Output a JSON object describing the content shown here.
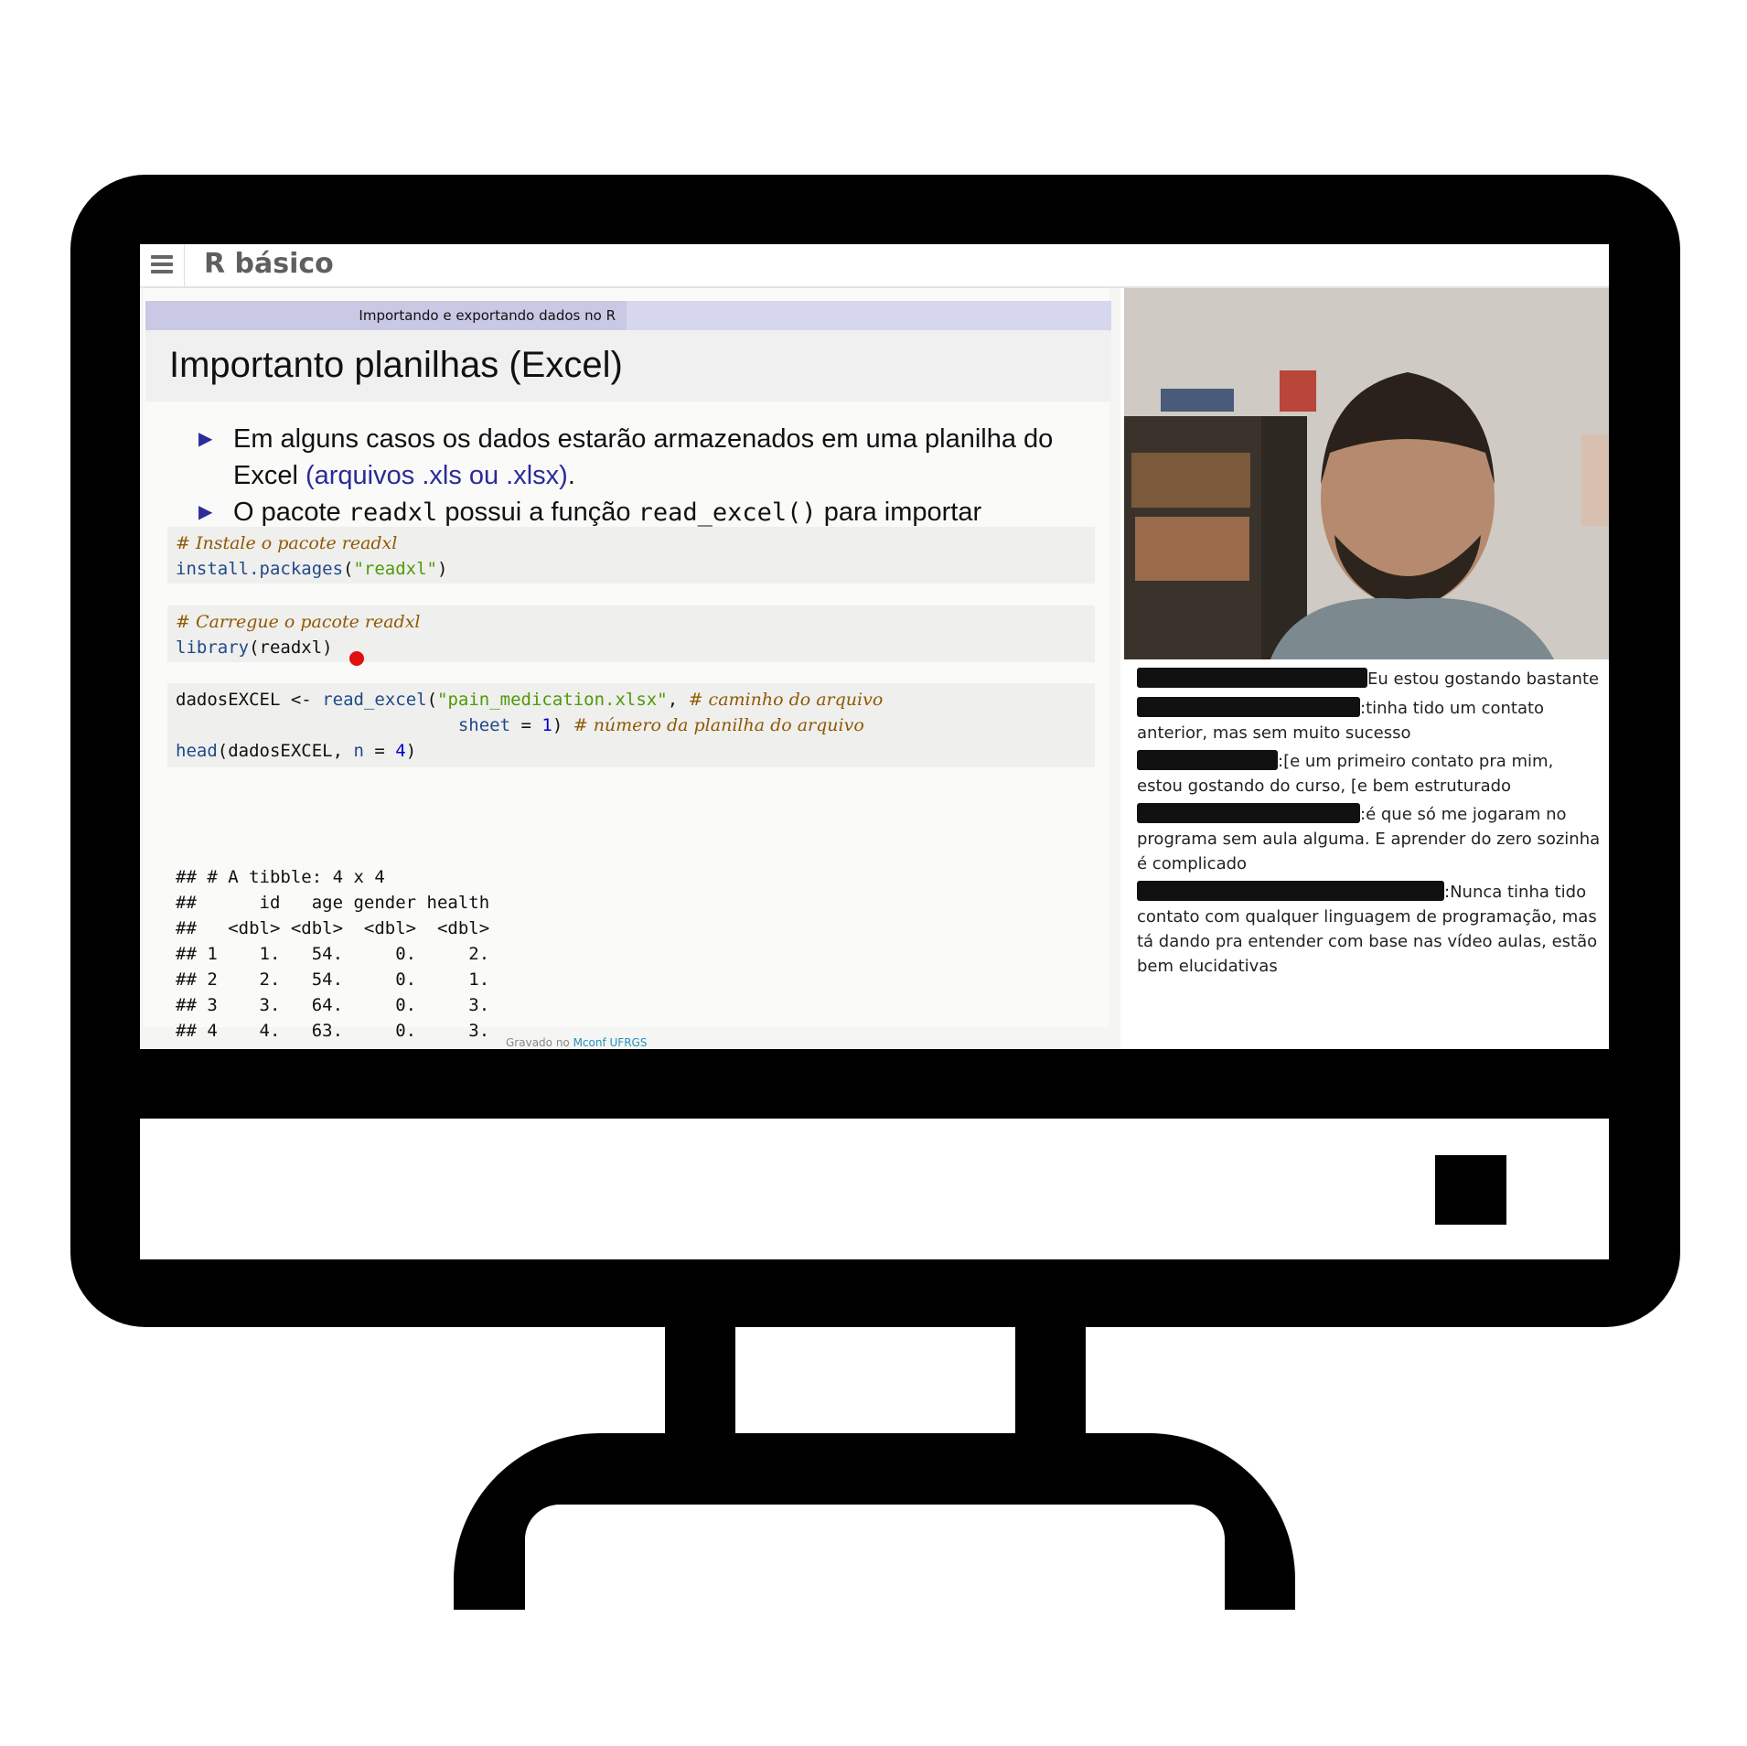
{
  "app": {
    "title": "R básico"
  },
  "slide": {
    "section": "Importando e exportando dados no R",
    "title": "Importanto planilhas (Excel)",
    "bullet1_a": "Em alguns casos os dados estarão armazenados em uma planilha do Excel ",
    "bullet1_b": "(arquivos .xls ou .xlsx)",
    "bullet1_c": ".",
    "bullet2_a": "O pacote ",
    "bullet2_b": "readxl",
    "bullet2_c": " possui a função ",
    "bullet2_d": "read_excel()",
    "bullet2_e": " para importar arquivos neste formato.",
    "code1_comment": "# Instale o pacote readxl",
    "code1_fn": "install.packages",
    "code1_open": "(",
    "code1_str": "\"readxl\"",
    "code1_close": ")",
    "code2_comment": "# Carregue o pacote readxl",
    "code2_fn": "library",
    "code2_rest": "(readxl)",
    "code3_var": "dadosEXCEL ",
    "code3_assign": "<-",
    "code3_space": " ",
    "code3_fn": "read_excel",
    "code3_open": "(",
    "code3_str": "\"pain_medication.xlsx\"",
    "code3_comma": ", ",
    "code3_comment1": "# caminho do arquivo",
    "code3_indent": "                           ",
    "code3_sheet": "sheet",
    "code3_eq": " = ",
    "code3_num": "1",
    "code3_close": ") ",
    "code3_comment2": "# número da planilha do arquivo",
    "code3_head": "head",
    "code3_head_args": "(dadosEXCEL, ",
    "code3_n": "n",
    "code3_n_eq": " = ",
    "code3_n_val": "4",
    "code3_head_close": ")",
    "output": "## # A tibble: 4 x 4\n##      id   age gender health\n##   <dbl> <dbl>  <dbl>  <dbl>\n## 1    1.   54.     0.     2.\n## 2    2.   54.     0.     1.\n## 3    3.   64.     0.     3.\n## 4    4.   63.     0.     3.",
    "footer_prefix": "Gravado no ",
    "footer_link": "Mconf UFRGS"
  },
  "chat": {
    "messages": [
      {
        "text": "Eu estou gostando bastante"
      },
      {
        "text": ":tinha tido um contato anterior, mas sem muito sucesso"
      },
      {
        "text": ":[e um primeiro contato pra mim, estou gostando do curso, [e bem estruturado"
      },
      {
        "text": ":é que só me jogaram no programa sem aula alguma. E aprender do zero sozinha é complicado"
      },
      {
        "text": ":Nunca tinha tido contato com qualquer linguagem de programação, mas tá dando pra entender com base nas vídeo aulas, estão bem elucidativas"
      }
    ]
  },
  "colors": {
    "accent": "#2b2b9a",
    "pointer": "#e01010"
  }
}
